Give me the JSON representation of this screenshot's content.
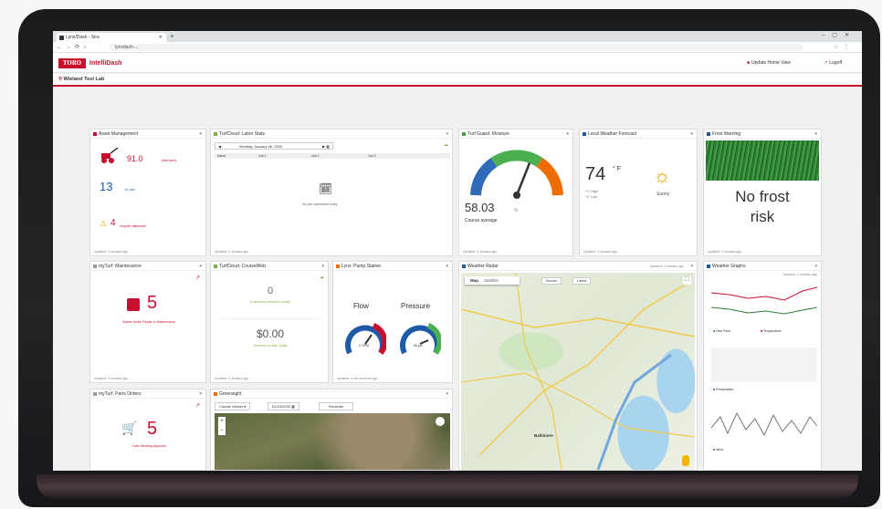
{
  "browser": {
    "tab_title": "Lynx/Dash - Sira",
    "new_tab": "+",
    "url": "lynxdash-..."
  },
  "app": {
    "logo": "TORO",
    "name": "IntelliDash",
    "update_btn": "Update Home View",
    "logoff_btn": "Logoff",
    "location": "Wieland Test Lab"
  },
  "asset_mgmt": {
    "title": "Asset Management",
    "hours": "91.0",
    "hours_unit": "total hours",
    "in_use": "13",
    "in_use_label": "in use",
    "attention": "4",
    "attention_label": "require attention",
    "footer": "Updated: 2 minutes ago"
  },
  "labor": {
    "title": "TurfCloud: Labor Stats",
    "date": "Monday, January 06, 2020",
    "cols": [
      "Name",
      "Job 1",
      "Job 2",
      "Job 3"
    ],
    "empty": "No jobs scheduled today.",
    "footer": "Updated: 2 minutes ago"
  },
  "moisture": {
    "title": "Turf Guard: Moisture",
    "value": "58.03",
    "unit": "%",
    "label": "Course average",
    "footer": "Updated: 2 minutes ago",
    "needle_fraction": 0.62
  },
  "weather": {
    "title": "Local Weather Forecast",
    "temp": "74",
    "deg": "° F",
    "high": "+1° High",
    "low": "+1° Low",
    "cond": "Sunny",
    "footer": "Updated: 2 minutes ago"
  },
  "frost": {
    "title": "Frost Warning",
    "line1": "No frost",
    "line2": "risk",
    "footer": "Updated: 2 minutes ago"
  },
  "maint": {
    "title": "myTurf: Maintenance",
    "count": "5",
    "label": "Assets Under Repair or Maintenance",
    "footer": "Updated: 4 minutes ago"
  },
  "courseweb": {
    "title": "TurfCloud: CourseWeb",
    "count": "0",
    "count_label": "Employees clocked in today",
    "money": "$0.00",
    "money_label": "Overtime to Date Today",
    "footer": "Updated: 2 minutes ago"
  },
  "pump": {
    "title": "Lynx: Pump Station",
    "flow": "Flow",
    "pressure": "Pressure",
    "flow_val": "0",
    "flow_unit": "GPM",
    "pressure_val": "56",
    "pressure_unit": "psi",
    "footer": "Updated: a few seconds ago"
  },
  "radar": {
    "title": "Weather Radar",
    "updated": "Updated: 2 minutes ago",
    "map_tab": "Map",
    "sat_tab": "Satellite",
    "btn1": "Sounds",
    "btn2": "Labels",
    "city": "Baltimore"
  },
  "graphs": {
    "title": "Weather Graphs",
    "updated": "Updated: 2 minutes ago",
    "legend1": "Dew Point",
    "legend2": "Temperature",
    "legend3": "Precipitation",
    "legend4": "Wind"
  },
  "parts": {
    "title": "myTurf: Parts Orders",
    "count": "5",
    "label": "Carts Needing Approval"
  },
  "greensight": {
    "title": "Greensight",
    "select": "Course Viewer",
    "date": "01/10/2020",
    "btn": "Recenter"
  },
  "colors": {
    "accent": "#c8102e",
    "green": "#4caf50",
    "blue": "#1e5aa8"
  }
}
